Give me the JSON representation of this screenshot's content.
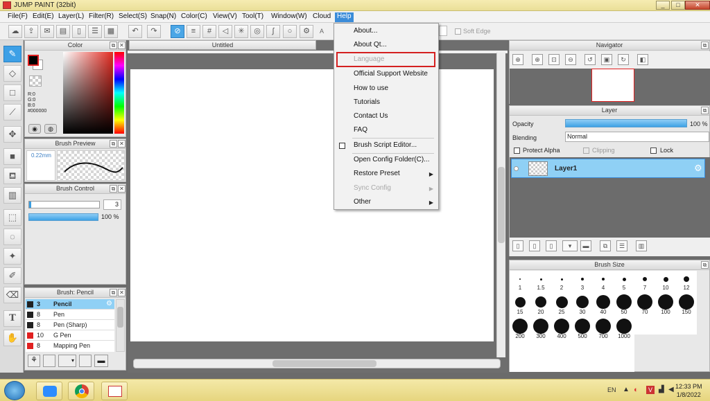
{
  "window": {
    "title": "JUMP PAINT (32bit)",
    "min": "_",
    "max": "□",
    "close": "✕"
  },
  "menubar": [
    "File(F)",
    "Edit(E)",
    "Layer(L)",
    "Filter(R)",
    "Select(S)",
    "Snap(N)",
    "Color(C)",
    "View(V)",
    "Tool(T)",
    "Window(W)",
    "Cloud",
    "Help"
  ],
  "toolbar": {
    "soft_edge": "Soft Edge",
    "a_label": "A"
  },
  "color_panel": {
    "title": "Color",
    "r": "R:0",
    "g": "G:0",
    "b": "B:0",
    "hex": "#000000"
  },
  "brush_preview": {
    "title": "Brush Preview",
    "size": "0.22mm"
  },
  "brush_control": {
    "title": "Brush Control",
    "size_value": "3",
    "opacity": "100 %"
  },
  "brush_list": {
    "title": "Brush: Pencil",
    "items": [
      {
        "size": "3",
        "name": "Pencil",
        "color": "#000000"
      },
      {
        "size": "8",
        "name": "Pen",
        "color": "#000000"
      },
      {
        "size": "8",
        "name": "Pen (Sharp)",
        "color": "#000000"
      },
      {
        "size": "10",
        "name": "G Pen",
        "color": "#e02020"
      },
      {
        "size": "8",
        "name": "Mapping Pen",
        "color": "#e02020"
      }
    ]
  },
  "document": {
    "tab": "Untitled"
  },
  "help_menu": {
    "about": "About...",
    "about_qt": "About Qt...",
    "language": "Language",
    "support": "Official Support Website",
    "how_to": "How to use",
    "tutorials": "Tutorials",
    "contact": "Contact Us",
    "faq": "FAQ",
    "brush_script": "Brush Script Editor...",
    "open_config": "Open Config Folder(C)...",
    "restore": "Restore Preset",
    "sync": "Sync Config",
    "other": "Other"
  },
  "navigator": {
    "title": "Navigator"
  },
  "layer_panel": {
    "title": "Layer",
    "opacity_label": "Opacity",
    "opacity_value": "100 %",
    "blending_label": "Blending",
    "blending_value": "Normal",
    "protect_alpha": "Protect Alpha",
    "clipping": "Clipping",
    "lock": "Lock",
    "layer_name": "Layer1"
  },
  "brush_size": {
    "title": "Brush Size",
    "sizes": [
      "1",
      "1.5",
      "2",
      "3",
      "4",
      "5",
      "7",
      "10",
      "12",
      "15",
      "20",
      "25",
      "30",
      "40",
      "50",
      "70",
      "100",
      "150",
      "200",
      "300",
      "400",
      "500",
      "700",
      "1000"
    ]
  },
  "taskbar": {
    "lang": "EN",
    "time": "12:33 PM",
    "date": "1/8/2022"
  },
  "colors": {
    "accent": "#3b8cd9",
    "highlight_box": "#d42020",
    "taskbar": "#efe29a"
  }
}
